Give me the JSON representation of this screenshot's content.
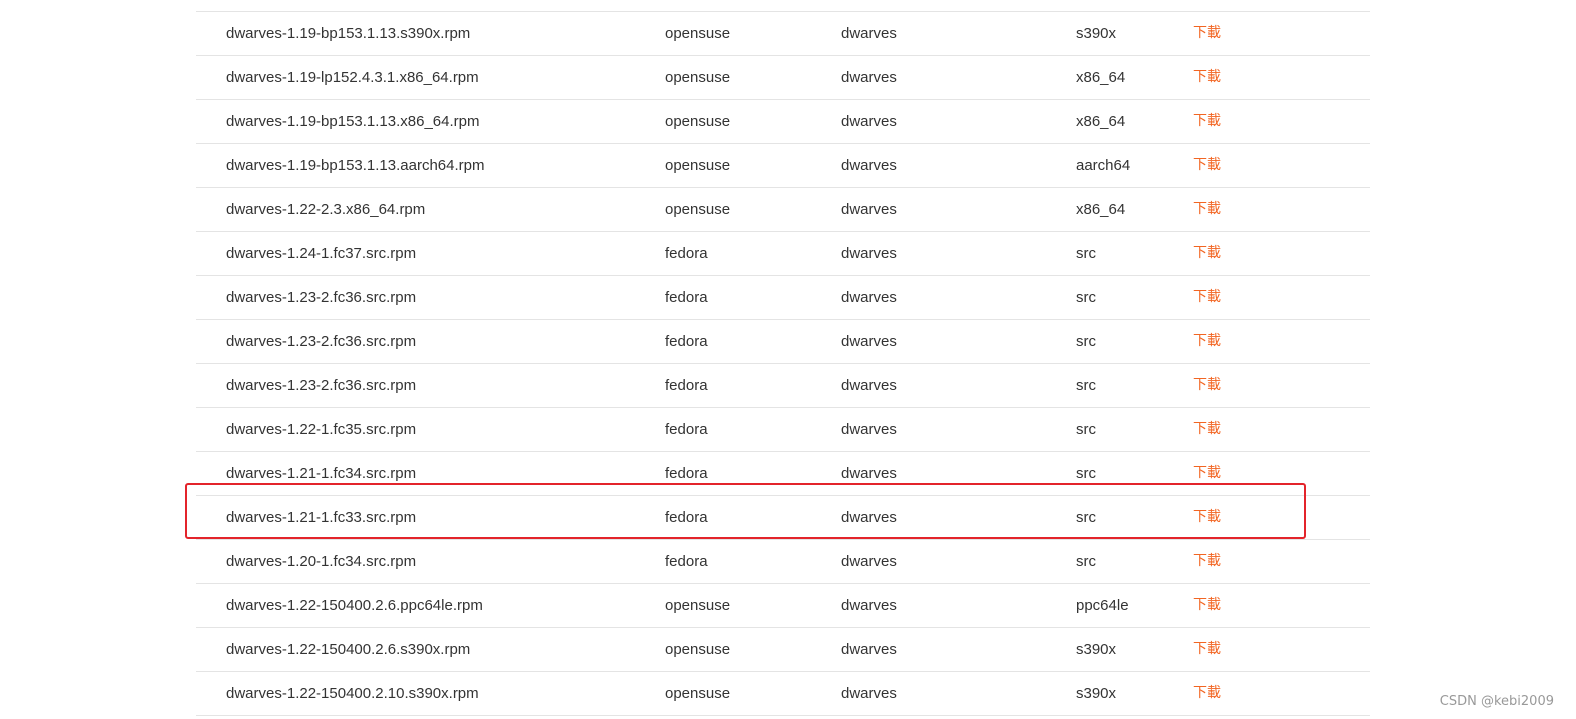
{
  "packages": [
    {
      "name": "dwarves-1.19-bp153.1.13.s390x.rpm",
      "distro": "opensuse",
      "package": "dwarves",
      "arch": "s390x",
      "download_label": "下載"
    },
    {
      "name": "dwarves-1.19-lp152.4.3.1.x86_64.rpm",
      "distro": "opensuse",
      "package": "dwarves",
      "arch": "x86_64",
      "download_label": "下載"
    },
    {
      "name": "dwarves-1.19-bp153.1.13.x86_64.rpm",
      "distro": "opensuse",
      "package": "dwarves",
      "arch": "x86_64",
      "download_label": "下載"
    },
    {
      "name": "dwarves-1.19-bp153.1.13.aarch64.rpm",
      "distro": "opensuse",
      "package": "dwarves",
      "arch": "aarch64",
      "download_label": "下載"
    },
    {
      "name": "dwarves-1.22-2.3.x86_64.rpm",
      "distro": "opensuse",
      "package": "dwarves",
      "arch": "x86_64",
      "download_label": "下載"
    },
    {
      "name": "dwarves-1.24-1.fc37.src.rpm",
      "distro": "fedora",
      "package": "dwarves",
      "arch": "src",
      "download_label": "下載"
    },
    {
      "name": "dwarves-1.23-2.fc36.src.rpm",
      "distro": "fedora",
      "package": "dwarves",
      "arch": "src",
      "download_label": "下載"
    },
    {
      "name": "dwarves-1.23-2.fc36.src.rpm",
      "distro": "fedora",
      "package": "dwarves",
      "arch": "src",
      "download_label": "下載"
    },
    {
      "name": "dwarves-1.23-2.fc36.src.rpm",
      "distro": "fedora",
      "package": "dwarves",
      "arch": "src",
      "download_label": "下載"
    },
    {
      "name": "dwarves-1.22-1.fc35.src.rpm",
      "distro": "fedora",
      "package": "dwarves",
      "arch": "src",
      "download_label": "下載"
    },
    {
      "name": "dwarves-1.21-1.fc34.src.rpm",
      "distro": "fedora",
      "package": "dwarves",
      "arch": "src",
      "download_label": "下載"
    },
    {
      "name": "dwarves-1.21-1.fc33.src.rpm",
      "distro": "fedora",
      "package": "dwarves",
      "arch": "src",
      "download_label": "下載"
    },
    {
      "name": "dwarves-1.20-1.fc34.src.rpm",
      "distro": "fedora",
      "package": "dwarves",
      "arch": "src",
      "download_label": "下載"
    },
    {
      "name": "dwarves-1.22-150400.2.6.ppc64le.rpm",
      "distro": "opensuse",
      "package": "dwarves",
      "arch": "ppc64le",
      "download_label": "下載"
    },
    {
      "name": "dwarves-1.22-150400.2.6.s390x.rpm",
      "distro": "opensuse",
      "package": "dwarves",
      "arch": "s390x",
      "download_label": "下載"
    },
    {
      "name": "dwarves-1.22-150400.2.10.s390x.rpm",
      "distro": "opensuse",
      "package": "dwarves",
      "arch": "s390x",
      "download_label": "下載"
    }
  ],
  "watermark": "CSDN @kebi2009",
  "colors": {
    "download_link": "#f26522",
    "highlight_border": "#e3242b",
    "row_divider": "#e4e4e4"
  }
}
